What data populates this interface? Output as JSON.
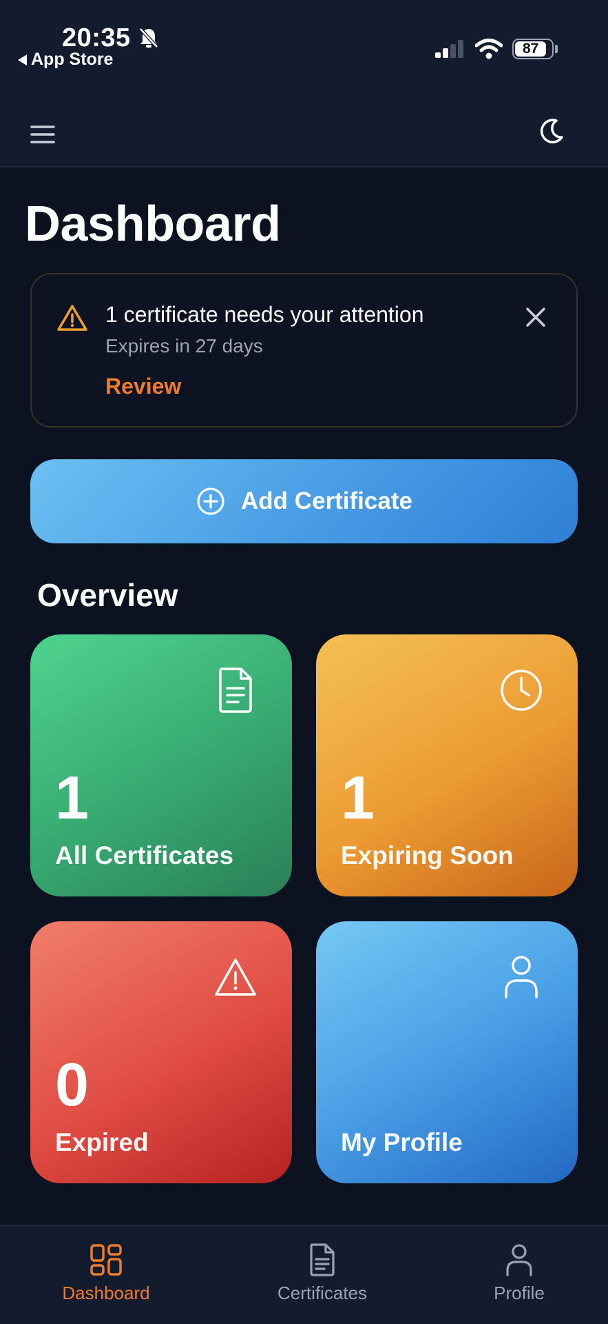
{
  "status_bar": {
    "time": "20:35",
    "back_label": "App Store",
    "battery": "87"
  },
  "page": {
    "title": "Dashboard"
  },
  "alert": {
    "title": "1 certificate needs your attention",
    "subtitle": "Expires in 27 days",
    "action": "Review"
  },
  "add_button": {
    "label": "Add Certificate"
  },
  "overview": {
    "title": "Overview",
    "tiles": [
      {
        "count": "1",
        "label": "All Certificates",
        "icon": "document-icon"
      },
      {
        "count": "1",
        "label": "Expiring Soon",
        "icon": "clock-icon"
      },
      {
        "count": "0",
        "label": "Expired",
        "icon": "warning-icon"
      },
      {
        "label": "My Profile",
        "icon": "user-icon"
      }
    ]
  },
  "bottom_nav": {
    "items": [
      {
        "label": "Dashboard",
        "icon": "dashboard-icon",
        "active": true
      },
      {
        "label": "Certificates",
        "icon": "document-icon",
        "active": false
      },
      {
        "label": "Profile",
        "icon": "user-icon",
        "active": false
      }
    ]
  },
  "colors": {
    "accent": "#f07c2a",
    "background": "#0b1220",
    "nav_inactive": "#9aa3b2"
  }
}
